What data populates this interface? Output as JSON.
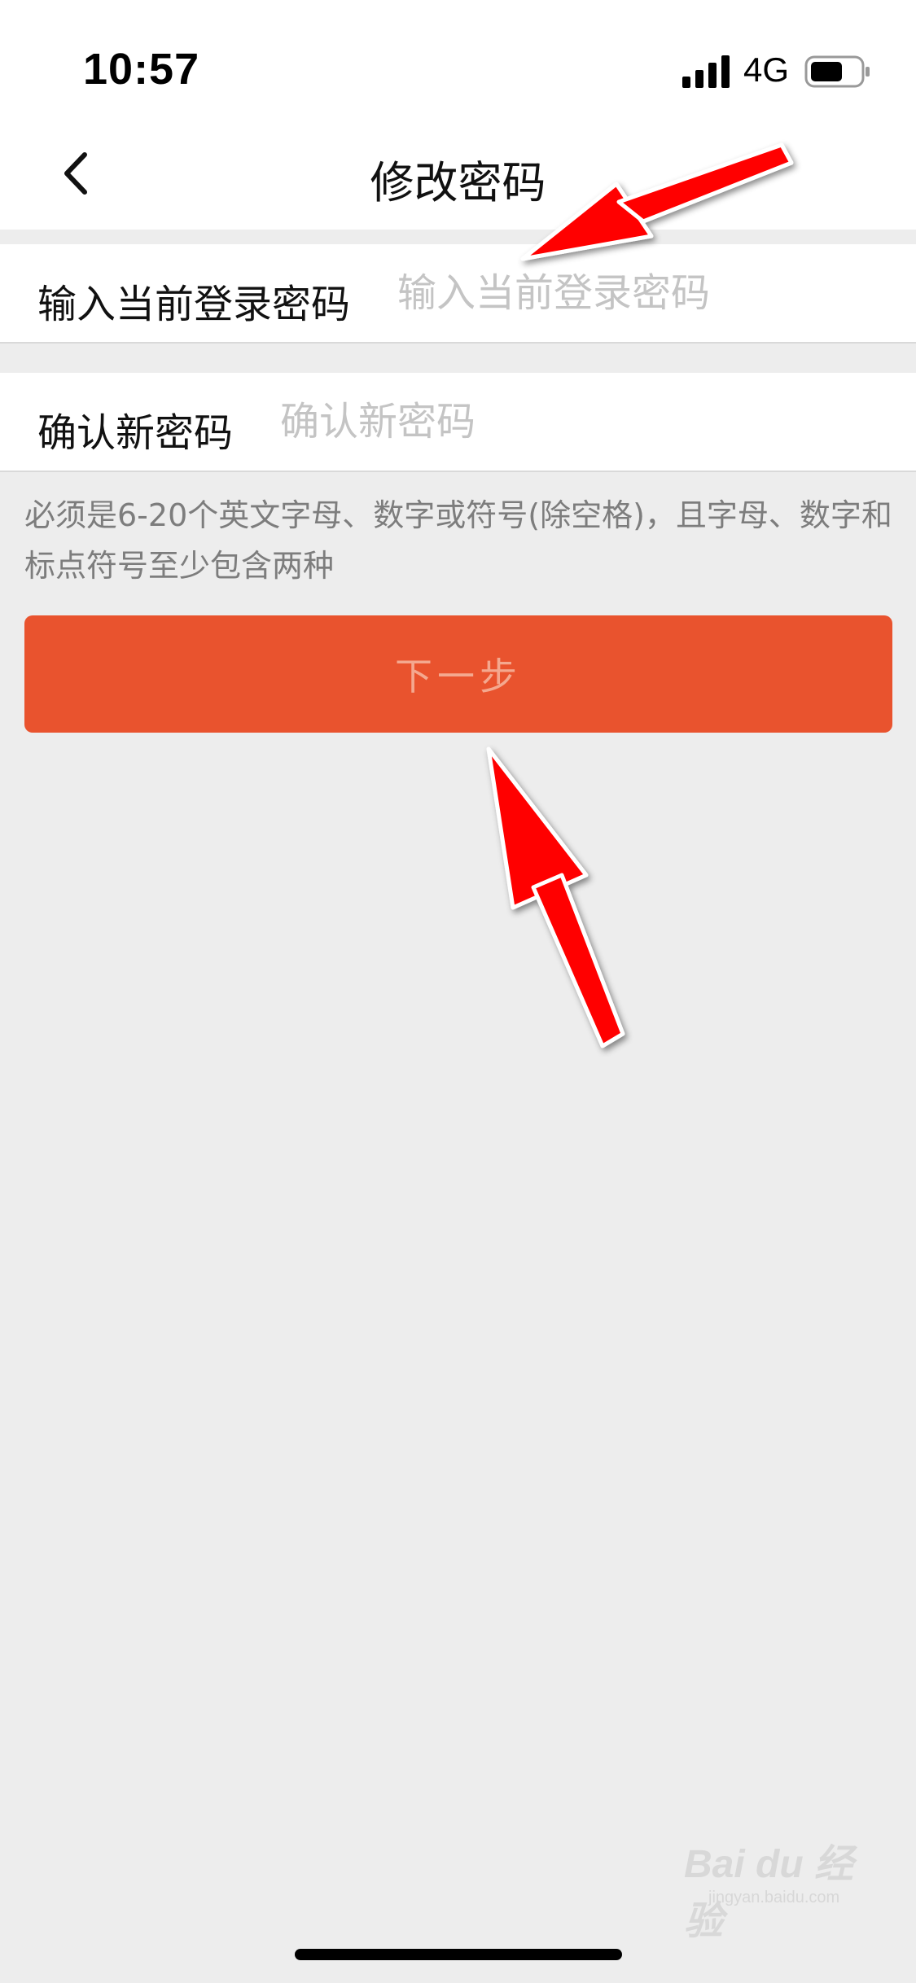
{
  "status_bar": {
    "time": "10:57",
    "network": "4G",
    "signal_icon": "signal-bars-icon",
    "battery_icon": "battery-icon"
  },
  "nav": {
    "title": "修改密码",
    "back_icon": "chevron-left-icon"
  },
  "form": {
    "current_password": {
      "label": "输入当前登录密码",
      "placeholder": "输入当前登录密码",
      "value": ""
    },
    "new_password": {
      "label": "确认新密码",
      "placeholder": "确认新密码",
      "value": ""
    },
    "hint": "必须是6-20个英文字母、数字或符号(除空格)，且字母、数字和标点符号至少包含两种",
    "next_button_label": "下一步"
  },
  "watermark": {
    "text": "Bai du 经验",
    "sub": "jingyan.baidu.com"
  },
  "colors": {
    "accent": "#e9532e",
    "background": "#ededed",
    "annotation_arrow": "#ff0000"
  }
}
